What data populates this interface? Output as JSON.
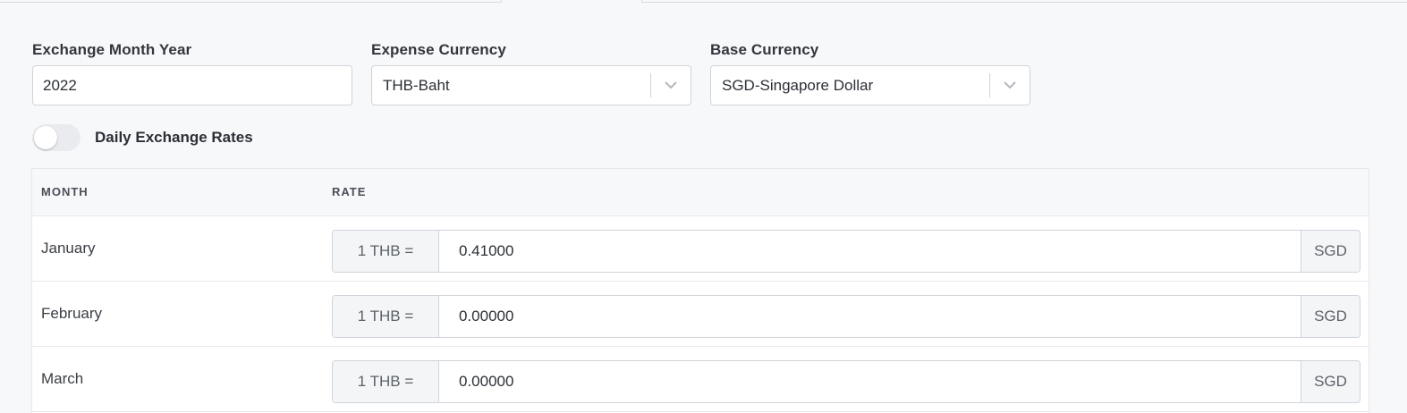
{
  "form": {
    "exchange_month_year": {
      "label": "Exchange Month Year",
      "value": "2022"
    },
    "expense_currency": {
      "label": "Expense Currency",
      "value": "THB-Baht"
    },
    "base_currency": {
      "label": "Base Currency",
      "value": "SGD-Singapore Dollar"
    }
  },
  "toggle": {
    "label": "Daily Exchange Rates",
    "checked": false
  },
  "table": {
    "headers": {
      "month": "MONTH",
      "rate": "RATE"
    },
    "rows": [
      {
        "month": "January",
        "prefix": "1 THB =",
        "rate": "0.41000",
        "suffix": "SGD"
      },
      {
        "month": "February",
        "prefix": "1 THB =",
        "rate": "0.00000",
        "suffix": "SGD"
      },
      {
        "month": "March",
        "prefix": "1 THB =",
        "rate": "0.00000",
        "suffix": "SGD"
      }
    ]
  },
  "icons": {
    "select_chevron": "chevron-down-icon"
  },
  "colors": {
    "background": "#f7f8fa",
    "border": "#cfd4da",
    "addon": "#f4f5f7"
  }
}
